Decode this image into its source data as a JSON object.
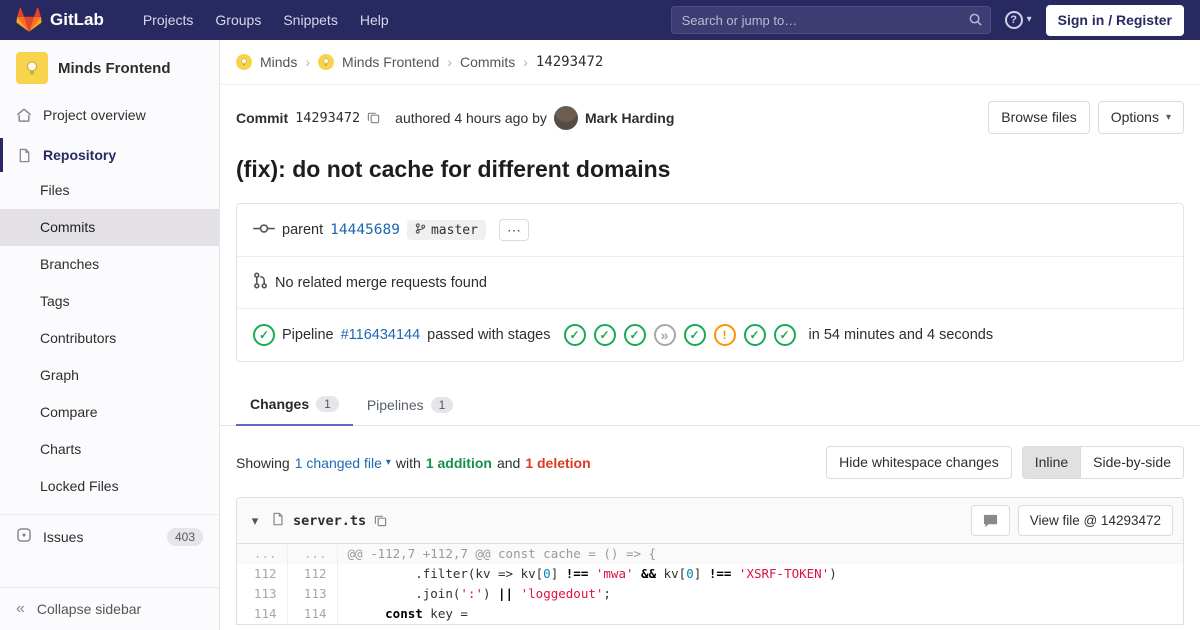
{
  "icons": {
    "caret_down": "▾",
    "separator": "›",
    "collapse": "«",
    "ellipsis": "⋯",
    "help": "?",
    "check": "✓",
    "skipped": "»",
    "warning": "!"
  },
  "navbar": {
    "brand": "GitLab",
    "menu": [
      "Projects",
      "Groups",
      "Snippets",
      "Help"
    ],
    "search_placeholder": "Search or jump to…",
    "sign_in": "Sign in / Register"
  },
  "sidebar": {
    "project_name": "Minds Frontend",
    "overview": "Project overview",
    "repository": "Repository",
    "repo_items": [
      "Files",
      "Commits",
      "Branches",
      "Tags",
      "Contributors",
      "Graph",
      "Compare",
      "Charts",
      "Locked Files"
    ],
    "issues": "Issues",
    "issues_count": "403",
    "collapse": "Collapse sidebar"
  },
  "breadcrumb": {
    "items": [
      "Minds",
      "Minds Frontend",
      "Commits",
      "14293472"
    ]
  },
  "commit": {
    "label": "Commit",
    "sha": "14293472",
    "authored": "authored 4 hours ago by",
    "author": "Mark Harding",
    "browse_files": "Browse files",
    "options": "Options",
    "title": "(fix): do not cache for different domains",
    "parent_label": "parent",
    "parent_sha": "14445689",
    "branch": "master",
    "no_merge_requests": "No related merge requests found",
    "pipeline_label": "Pipeline",
    "pipeline_id": "#116434144",
    "pipeline_status_text": "passed with stages",
    "pipeline_overall": "passed",
    "stages": [
      "passed",
      "passed",
      "passed",
      "skipped",
      "passed",
      "warning",
      "passed",
      "passed"
    ],
    "pipeline_duration": "in 54 minutes and 4 seconds"
  },
  "tabs": [
    {
      "label": "Changes",
      "count": "1"
    },
    {
      "label": "Pipelines",
      "count": "1"
    }
  ],
  "changes_bar": {
    "showing": "Showing",
    "changed_files": "1 changed file",
    "with": "with",
    "additions": "1 addition",
    "and": "and",
    "deletions": "1 deletion",
    "hide_whitespace": "Hide whitespace changes",
    "inline": "Inline",
    "side_by_side": "Side-by-side"
  },
  "diff": {
    "file_name": "server.ts",
    "view_file": "View file @ 14293472",
    "lines": [
      {
        "type": "match",
        "old": "...",
        "new": "...",
        "segments": [
          {
            "text": "@@ -112,7 +112,7 @@ const cache = () => {",
            "cls": "sx-match"
          }
        ]
      },
      {
        "type": "context",
        "old": "112",
        "new": "112",
        "segments": [
          {
            "text": "         .filter(kv => kv[",
            "cls": ""
          },
          {
            "text": "0",
            "cls": "sx-num"
          },
          {
            "text": "] ",
            "cls": ""
          },
          {
            "text": "!==",
            "cls": "sx-op"
          },
          {
            "text": " ",
            "cls": ""
          },
          {
            "text": "'mwa'",
            "cls": "sx-str"
          },
          {
            "text": " ",
            "cls": ""
          },
          {
            "text": "&&",
            "cls": "sx-op"
          },
          {
            "text": " kv[",
            "cls": ""
          },
          {
            "text": "0",
            "cls": "sx-num"
          },
          {
            "text": "] ",
            "cls": ""
          },
          {
            "text": "!==",
            "cls": "sx-op"
          },
          {
            "text": " ",
            "cls": ""
          },
          {
            "text": "'XSRF-TOKEN'",
            "cls": "sx-str"
          },
          {
            "text": ")",
            "cls": ""
          }
        ]
      },
      {
        "type": "context",
        "old": "113",
        "new": "113",
        "segments": [
          {
            "text": "         .join(",
            "cls": ""
          },
          {
            "text": "':'",
            "cls": "sx-str"
          },
          {
            "text": ") ",
            "cls": ""
          },
          {
            "text": "||",
            "cls": "sx-op"
          },
          {
            "text": " ",
            "cls": ""
          },
          {
            "text": "'loggedout'",
            "cls": "sx-str"
          },
          {
            "text": ";",
            "cls": ""
          }
        ]
      },
      {
        "type": "context",
        "old": "114",
        "new": "114",
        "segments": [
          {
            "text": "     ",
            "cls": ""
          },
          {
            "text": "const",
            "cls": "sx-kw"
          },
          {
            "text": " key =",
            "cls": ""
          }
        ]
      }
    ]
  },
  "colors": {
    "navbar": "#292961",
    "link": "#1b69b6",
    "success": "#1aaa55",
    "warning": "#fc9403",
    "danger": "#db3b21",
    "tab_accent": "#6666c4"
  }
}
